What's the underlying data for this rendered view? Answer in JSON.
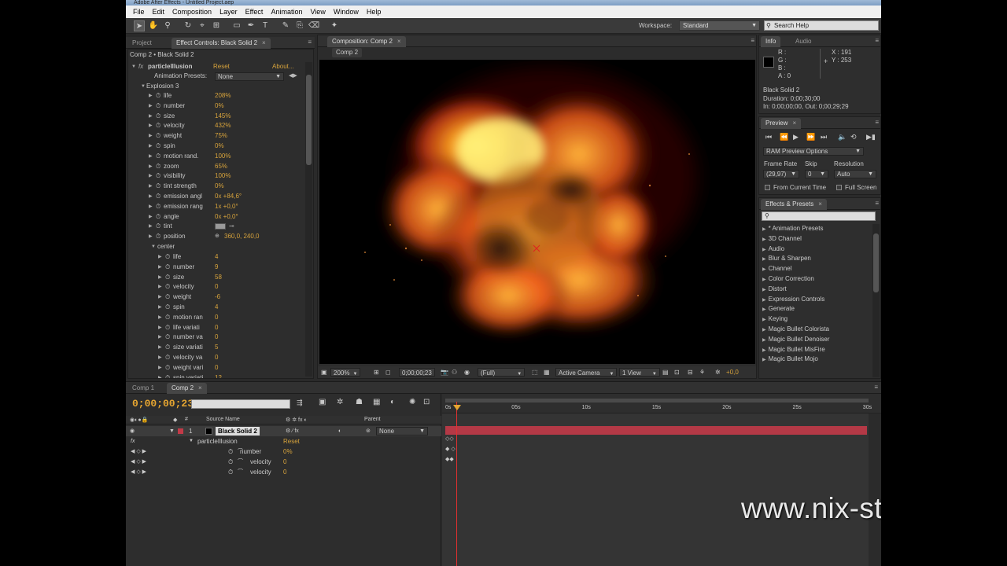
{
  "window": {
    "title": "Adobe After Effects - Untitled Project.aep"
  },
  "menu": [
    "File",
    "Edit",
    "Composition",
    "Layer",
    "Effect",
    "Animation",
    "View",
    "Window",
    "Help"
  ],
  "toolbar": {
    "workspace_label": "Workspace:",
    "workspace_value": "Standard",
    "search_placeholder": "Search Help"
  },
  "project_tab": "Project",
  "effect_controls": {
    "tab": "Effect Controls: Black Solid 2",
    "header": "Comp 2 • Black Solid 2",
    "effect_name": "particleIllusion",
    "reset": "Reset",
    "about": "About...",
    "presets_label": "Animation Presets:",
    "presets_value": "None",
    "group1": "Explosion 3",
    "params1": [
      {
        "name": "life",
        "value": "208%"
      },
      {
        "name": "number",
        "value": "0%"
      },
      {
        "name": "size",
        "value": "145%"
      },
      {
        "name": "velocity",
        "value": "432%"
      },
      {
        "name": "weight",
        "value": "75%"
      },
      {
        "name": "spin",
        "value": "0%"
      },
      {
        "name": "motion rand.",
        "value": "100%"
      },
      {
        "name": "zoom",
        "value": "65%"
      },
      {
        "name": "visibility",
        "value": "100%"
      },
      {
        "name": "tint strength",
        "value": "0%"
      },
      {
        "name": "emission angl",
        "value": "0x +84,6°"
      },
      {
        "name": "emission rang",
        "value": "1x +0,0°"
      },
      {
        "name": "angle",
        "value": "0x +0,0°"
      },
      {
        "name": "tint",
        "value": ""
      },
      {
        "name": "position",
        "value": "360,0, 240,0"
      }
    ],
    "group2": "center",
    "params2": [
      {
        "name": "life",
        "value": "4"
      },
      {
        "name": "number",
        "value": "9"
      },
      {
        "name": "size",
        "value": "58"
      },
      {
        "name": "velocity",
        "value": "0"
      },
      {
        "name": "weight",
        "value": "-6"
      },
      {
        "name": "spin",
        "value": "4"
      },
      {
        "name": "motion ran",
        "value": "0"
      },
      {
        "name": "life variati",
        "value": "0"
      },
      {
        "name": "number va",
        "value": "0"
      },
      {
        "name": "size variati",
        "value": "5"
      },
      {
        "name": "velocity va",
        "value": "0"
      },
      {
        "name": "weight vari",
        "value": "0"
      },
      {
        "name": "spin variati",
        "value": "12"
      }
    ]
  },
  "composition": {
    "tab": "Composition: Comp 2",
    "inner_tab": "Comp 2",
    "zoom": "200%",
    "timecode": "0;00;00;23",
    "resolution": "(Full)",
    "camera": "Active Camera",
    "views": "1 View",
    "exposure": "+0,0"
  },
  "info": {
    "tab": "Info",
    "audio_tab": "Audio",
    "r": "R :",
    "g": "G :",
    "b": "B :",
    "a": "A : 0",
    "x": "X : 191",
    "y": "Y : 253",
    "layer_name": "Black Solid 2",
    "duration": "Duration: 0;00;30;00",
    "inout": "In: 0;00;00;00, Out: 0;00;29;29"
  },
  "preview": {
    "tab": "Preview",
    "ram_options": "RAM Preview Options",
    "frame_rate_label": "Frame Rate",
    "skip_label": "Skip",
    "resolution_label": "Resolution",
    "frame_rate": "(29,97)",
    "skip": "0",
    "resolution": "Auto",
    "from_current": "From Current Time",
    "full_screen": "Full Screen"
  },
  "effects_presets": {
    "tab": "Effects & Presets",
    "categories": [
      "* Animation Presets",
      "3D Channel",
      "Audio",
      "Blur & Sharpen",
      "Channel",
      "Color Correction",
      "Distort",
      "Expression Controls",
      "Generate",
      "Keying",
      "Magic Bullet Colorista",
      "Magic Bullet Denoiser",
      "Magic Bullet MisFire",
      "Magic Bullet Mojo"
    ]
  },
  "timeline": {
    "tabs": [
      "Comp 1",
      "Comp 2"
    ],
    "timecode": "0;00;00;23",
    "col_source": "Source Name",
    "col_parent": "Parent",
    "layer_num": "1",
    "layer_name": "Black Solid 2",
    "parent_value": "None",
    "effect_name": "particleIllusion",
    "reset": "Reset",
    "props": [
      {
        "name": "number",
        "value": "0%"
      },
      {
        "name": "velocity",
        "value": "0"
      },
      {
        "name": "velocity",
        "value": "0"
      }
    ],
    "ruler": [
      "0s",
      "05s",
      "10s",
      "15s",
      "20s",
      "25s",
      "30s"
    ]
  },
  "watermark": "www.nix-studio-edition.ru",
  "colors": {
    "accent": "#d7a33c",
    "layer_bar": "#c23a48",
    "playhead": "#e03030"
  }
}
